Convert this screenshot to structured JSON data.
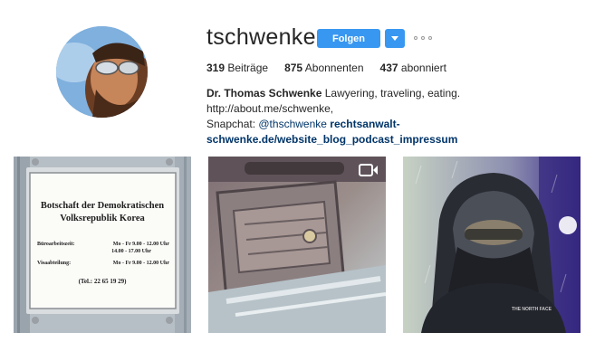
{
  "profile": {
    "username": "tschwenke",
    "follow_label": "Folgen",
    "stats": {
      "posts_count": "319",
      "posts_label": "Beiträge",
      "followers_count": "875",
      "followers_label": "Abonnenten",
      "following_count": "437",
      "following_label": "abonniert"
    },
    "bio": {
      "name": "Dr. Thomas Schwenke",
      "text1": " Lawyering, traveling, eating. http://about.me/schwenke,",
      "text2": "Snapchat: ",
      "mention": "@thschwenke",
      "space": " ",
      "link": "rechtsanwalt-schwenke.de/website_blog_podcast_impressum"
    }
  },
  "posts": [
    {
      "sign_title_1": "Botschaft der Demokratischen",
      "sign_title_2": "Volksrepublik Korea",
      "hours_label": "Büroarbeitszeit:",
      "hours_line_1": "Mo - Fr  9.00 - 12.00 Uhr",
      "hours_line_2": "14.00 - 17.00 Uhr",
      "visa_label": "Visaabteilung:",
      "visa_line": "Mo - Fr  9.00 - 12.00 Uhr",
      "phone": "(Tel.: 22 65 19 29)"
    },
    {
      "type": "video",
      "icon": "video-camera-icon"
    },
    {
      "type": "photo",
      "jacket_text": "THE NORTH FACE"
    }
  ],
  "colors": {
    "accent": "#3897f0",
    "link": "#003569",
    "text": "#262626"
  }
}
